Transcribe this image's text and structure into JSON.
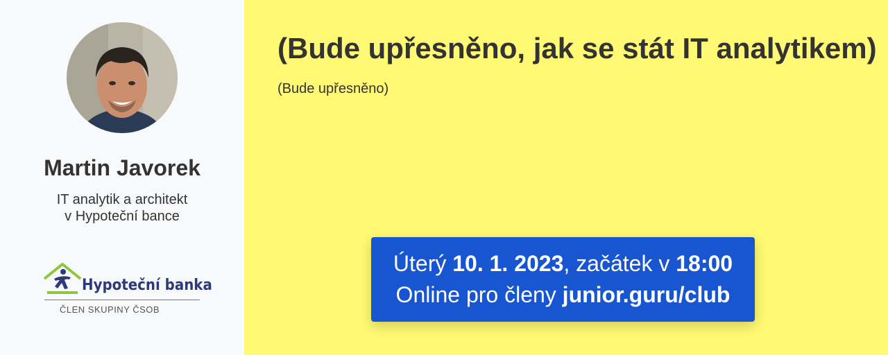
{
  "speaker": {
    "name": "Martin Javorek",
    "bio_line1": "IT analytik a architekt",
    "bio_line2": "v Hypoteční bance"
  },
  "logo": {
    "brand": "Hypoteční banka",
    "subtitle": "ČLEN SKUPINY ČSOB",
    "colors": {
      "roof": "#8dc63f",
      "figure": "#2d3a7a"
    }
  },
  "event": {
    "title": "(Bude upřesněno, jak se stát IT analytikem)",
    "description": "(Bude upřesněno)"
  },
  "info": {
    "day": "Úterý",
    "date": "10. 1. 2023",
    "start_label": ", začátek v",
    "time": "18:00",
    "online_label": "Online pro členy",
    "club_link": "junior.guru/club"
  },
  "colors": {
    "sidebar_bg": "#f8f9fa",
    "main_bg": "#fff973",
    "info_bg": "#1755d1",
    "text": "#333333"
  }
}
